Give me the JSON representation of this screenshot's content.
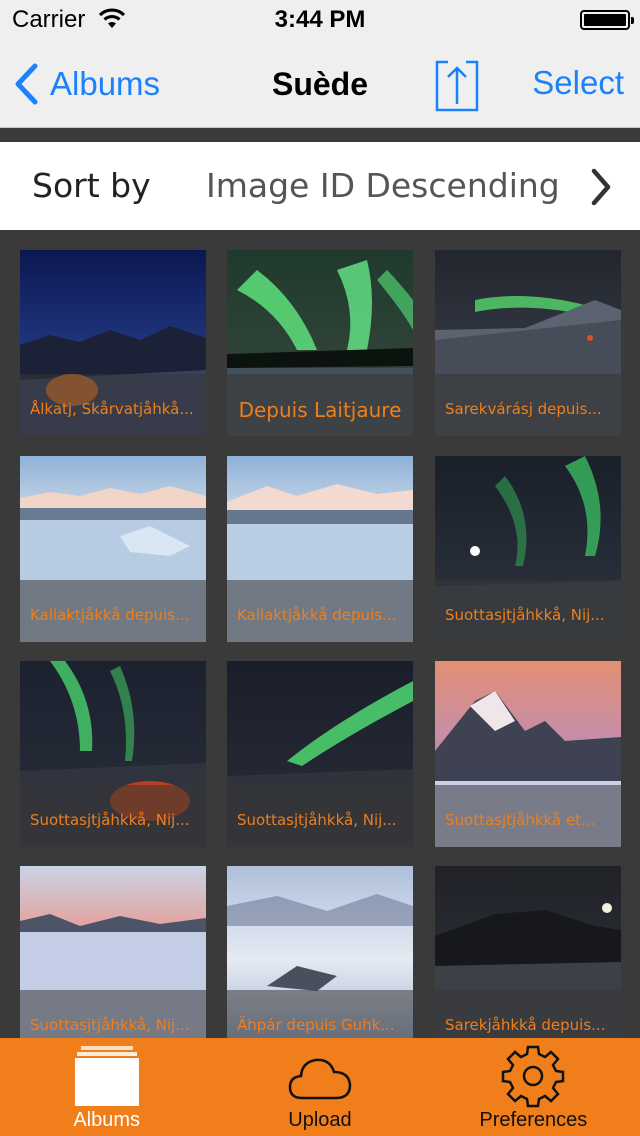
{
  "status": {
    "carrier": "Carrier",
    "time": "3:44 PM"
  },
  "nav": {
    "back_label": "Albums",
    "title": "Suède",
    "select_label": "Select"
  },
  "sort": {
    "label": "Sort by",
    "value": "Image ID Descending"
  },
  "tiles": [
    {
      "caption": "Ålkatj, Skårvatjåhkå..."
    },
    {
      "caption": "Depuis Laitjaure"
    },
    {
      "caption": "Sarekvárásj depuis..."
    },
    {
      "caption": "Kallaktjåkkå depuis..."
    },
    {
      "caption": "Kallaktjåkkå depuis..."
    },
    {
      "caption": "Suottasjtjåhkkå, Nij..."
    },
    {
      "caption": "Suottasjtjåhkkå, Nij..."
    },
    {
      "caption": "Suottasjtjåhkkå, Nij..."
    },
    {
      "caption": "Suottasjtjåhkkå et..."
    },
    {
      "caption": "Suottasjtjåhkkå, Nij..."
    },
    {
      "caption": "Ähpár depuis Guhk..."
    },
    {
      "caption": "Sarekjåhkkå depuis..."
    }
  ],
  "tabs": [
    {
      "label": "Albums"
    },
    {
      "label": "Upload"
    },
    {
      "label": "Preferences"
    }
  ],
  "colors": {
    "accent": "#f07e1a",
    "link": "#1a82fb",
    "nav_bg": "#efefef",
    "grid_bg": "#3a3a3a"
  }
}
